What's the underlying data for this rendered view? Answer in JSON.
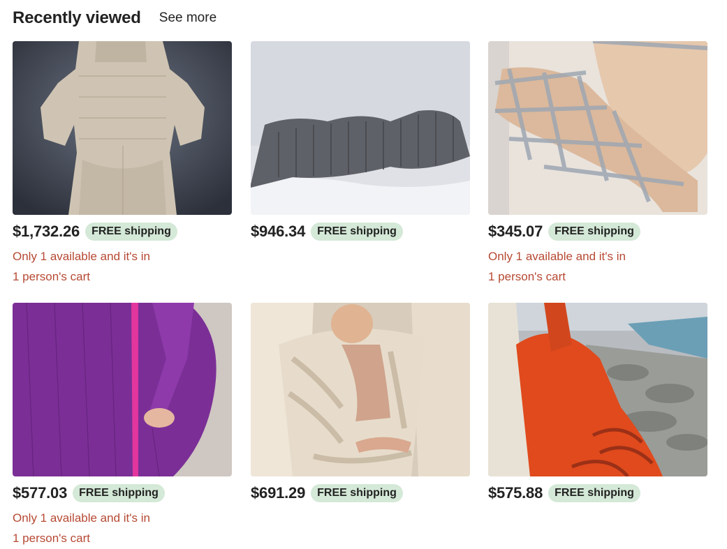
{
  "section": {
    "title": "Recently viewed",
    "see_more_label": "See more"
  },
  "listings": [
    {
      "price": "$1,732.26",
      "shipping": "FREE shipping",
      "stock_line1": "Only 1 available and it's in",
      "stock_line2": "1 person's cart",
      "image": "beige crochet bodysuit on dark background"
    },
    {
      "price": "$946.34",
      "shipping": "FREE shipping",
      "stock_line1": "",
      "stock_line2": "",
      "image": "gray chunky knit garment lying on white bed"
    },
    {
      "price": "$345.07",
      "shipping": "FREE shipping",
      "stock_line1": "Only 1 available and it's in",
      "stock_line2": "1 person's cart",
      "image": "gray mesh crochet legwear"
    },
    {
      "price": "$577.03",
      "shipping": "FREE shipping",
      "stock_line1": "Only 1 available and it's in",
      "stock_line2": "1 person's cart",
      "image": "purple mohair knit bodysuit"
    },
    {
      "price": "$691.29",
      "shipping": "FREE shipping",
      "stock_line1": "",
      "stock_line2": "",
      "image": "cream chunky knit wrap"
    },
    {
      "price": "$575.88",
      "shipping": "FREE shipping",
      "stock_line1": "",
      "stock_line2": "",
      "image": "orange knit bodysuit by the sea"
    }
  ],
  "colors": {
    "shipping_badge_bg": "#d4e9d7",
    "stock_text": "#b64933"
  }
}
